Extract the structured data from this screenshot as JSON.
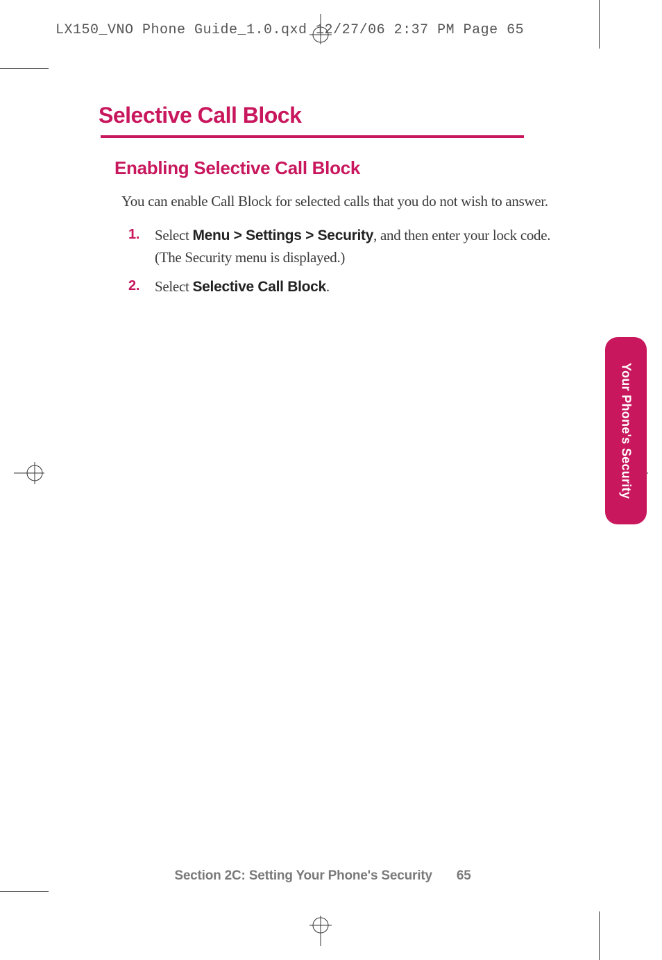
{
  "slug": "LX150_VNO Phone Guide_1.0.qxd  12/27/06  2:37 PM  Page 65",
  "main_heading": "Selective Call Block",
  "sub_heading": "Enabling Selective Call Block",
  "intro_text": "You can enable Call Block for selected calls that you do not wish to answer.",
  "steps": [
    {
      "num": "1.",
      "prefix": "Select ",
      "bold": "Menu > Settings > Security",
      "suffix": ", and then enter your lock code. (The Security menu is displayed.)"
    },
    {
      "num": "2.",
      "prefix": "Select ",
      "bold": "Selective Call Block",
      "suffix": "."
    }
  ],
  "side_tab": "Your Phone's Security",
  "footer_section": "Section 2C: Setting Your Phone's Security",
  "footer_page": "65"
}
